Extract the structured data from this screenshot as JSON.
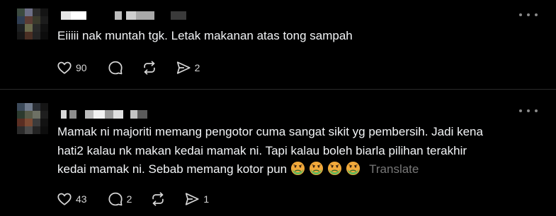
{
  "posts": [
    {
      "text": "Eiiiii nak muntah tgk. Letak makanan atas tong sampah",
      "translate_label": "",
      "actions": {
        "like_count": "90",
        "reply_count": "",
        "repost_count": "",
        "share_count": "2"
      }
    },
    {
      "text_lines": [
        "Mamak ni majoriti memang pengotor cuma sangat sikit yg pembersih. Jadi kena",
        "hati2 kalau nk makan kedai mamak ni. Tapi kalau boleh biarla pilihan terakhir",
        "kedai mamak ni. Sebab memang kotor pun"
      ],
      "emoji": [
        "nauseated-face",
        "nauseated-face",
        "nauseated-face",
        "nauseated-face"
      ],
      "translate_label": "Translate",
      "actions": {
        "like_count": "43",
        "reply_count": "2",
        "repost_count": "",
        "share_count": "1"
      }
    }
  ],
  "icons": {
    "more": "more-horizontal-icon",
    "like": "heart-icon",
    "reply": "comment-bubble-icon",
    "repost": "repost-arrows-icon",
    "share": "send-paper-plane-icon"
  },
  "colors": {
    "background": "#000000",
    "text": "#f3f5f7",
    "muted": "#777777",
    "icon": "#d6d6d6",
    "divider": "#2a2a2a"
  }
}
